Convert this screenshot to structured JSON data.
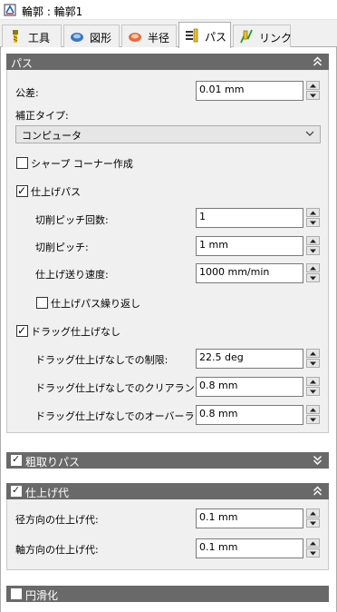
{
  "window": {
    "title": "輪郭 : 輪郭1"
  },
  "tabs": [
    {
      "label": "工具",
      "icon": "tool-icon"
    },
    {
      "label": "図形",
      "icon": "shape-icon"
    },
    {
      "label": "半径",
      "icon": "radius-icon"
    },
    {
      "label": "パス",
      "icon": "pass-icon",
      "active": true
    },
    {
      "label": "リンク",
      "icon": "link-icon"
    }
  ],
  "pass_section": {
    "title": "パス",
    "tolerance": {
      "label": "公差:",
      "value": "0.01 mm"
    },
    "compensation_type": {
      "label": "補正タイプ:",
      "selected": "コンピュータ"
    },
    "sharp_corners": {
      "label": "シャープ コーナー作成",
      "checked": false
    },
    "finishing_pass": {
      "label": "仕上げパス",
      "checked": true
    },
    "num_stepdowns": {
      "label": "切削ピッチ回数:",
      "value": "1"
    },
    "stepdown": {
      "label": "切削ピッチ:",
      "value": "1 mm"
    },
    "finishing_feedrate": {
      "label": "仕上げ送り速度:",
      "value": "1000 mm/min"
    },
    "repeat_finishing": {
      "label": "仕上げパス繰り返し",
      "checked": false
    },
    "no_finishing_drag": {
      "label": "ドラッグ仕上げなし",
      "checked": true
    },
    "drag_limit": {
      "label": "ドラッグ仕上げなしでの制限:",
      "value": "22.5 deg"
    },
    "drag_clearance": {
      "label": "ドラッグ仕上げなしでのクリアランス:",
      "value": "0.8 mm"
    },
    "drag_overlap": {
      "label": "ドラッグ仕上げなしでのオーバーラップ:",
      "value": "0.8 mm"
    }
  },
  "roughing_section": {
    "title": "粗取りパス",
    "checked": true
  },
  "stock_section": {
    "title": "仕上げ代",
    "checked": true,
    "radial": {
      "label": "径方向の仕上げ代:",
      "value": "0.1 mm"
    },
    "axial": {
      "label": "軸方向の仕上げ代:",
      "value": "0.1 mm"
    }
  },
  "smoothing_section": {
    "title": "円滑化",
    "checked": false
  }
}
